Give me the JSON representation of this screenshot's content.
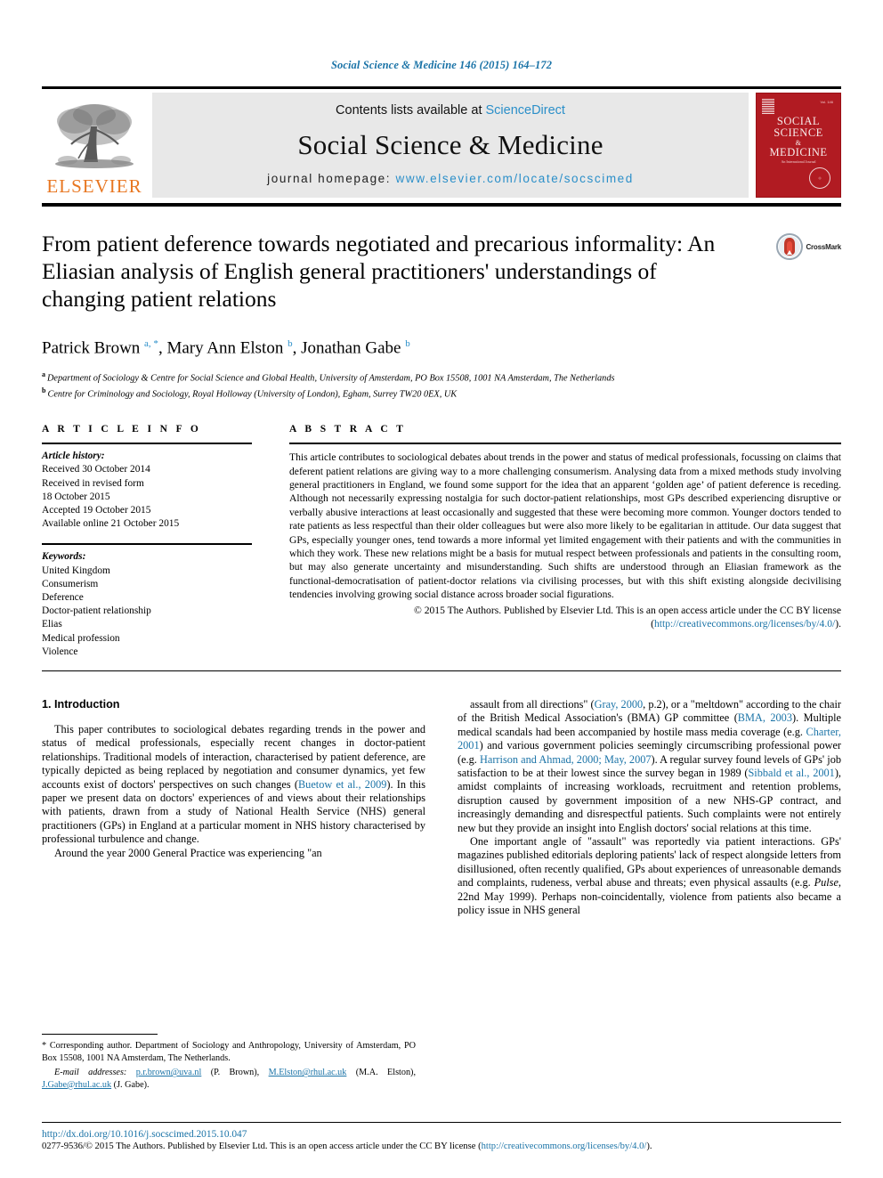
{
  "running_head": "Social Science & Medicine 146 (2015) 164–172",
  "masthead": {
    "contents_prefix": "Contents lists available at ",
    "contents_link": "ScienceDirect",
    "journal_name": "Social Science & Medicine",
    "homepage_prefix": "journal homepage: ",
    "homepage_url": "www.elsevier.com/locate/socscimed",
    "publisher_name": "ELSEVIER",
    "publisher_logo_icon": "elsevier-tree-icon",
    "cover": {
      "line1": "SOCIAL",
      "line2": "SCIENCE",
      "amp": "&",
      "line3": "MEDICINE",
      "subtitle": "An International Journal",
      "corner_label": "Vol. 146"
    },
    "colors": {
      "link": "#2b8fc9",
      "elsevier_orange": "#E87722",
      "cover_red": "#b11b22",
      "band": "#e8e8e8"
    }
  },
  "article": {
    "title": "From patient deference towards negotiated and precarious informality: An Eliasian analysis of English general practitioners' understandings of changing patient relations",
    "authors": [
      {
        "name": "Patrick Brown",
        "marks": "a, *"
      },
      {
        "name": "Mary Ann Elston",
        "marks": "b"
      },
      {
        "name": "Jonathan Gabe",
        "marks": "b"
      }
    ],
    "affiliations": [
      {
        "mark": "a",
        "text": "Department of Sociology & Centre for Social Science and Global Health, University of Amsterdam, PO Box 15508, 1001 NA Amsterdam, The Netherlands"
      },
      {
        "mark": "b",
        "text": "Centre for Criminology and Sociology, Royal Holloway (University of London), Egham, Surrey TW20 0EX, UK"
      }
    ],
    "crossmark_label": "CrossMark"
  },
  "article_info": {
    "heading": "ARTICLE INFO",
    "history_label": "Article history:",
    "history": [
      "Received 30 October 2014",
      "Received in revised form",
      "18 October 2015",
      "Accepted 19 October 2015",
      "Available online 21 October 2015"
    ],
    "keywords_label": "Keywords:",
    "keywords": [
      "United Kingdom",
      "Consumerism",
      "Deference",
      "Doctor-patient relationship",
      "Elias",
      "Medical profession",
      "Violence"
    ]
  },
  "abstract": {
    "heading": "ABSTRACT",
    "text": "This article contributes to sociological debates about trends in the power and status of medical professionals, focussing on claims that deferent patient relations are giving way to a more challenging consumerism. Analysing data from a mixed methods study involving general practitioners in England, we found some support for the idea that an apparent ‘golden age’ of patient deference is receding. Although not necessarily expressing nostalgia for such doctor-patient relationships, most GPs described experiencing disruptive or verbally abusive interactions at least occasionally and suggested that these were becoming more common. Younger doctors tended to rate patients as less respectful than their older colleagues but were also more likely to be egalitarian in attitude. Our data suggest that GPs, especially younger ones, tend towards a more informal yet limited engagement with their patients and with the communities in which they work. These new relations might be a basis for mutual respect between professionals and patients in the consulting room, but may also generate uncertainty and misunderstanding. Such shifts are understood through an Eliasian framework as the functional-democratisation of patient-doctor relations via civilising processes, but with this shift existing alongside decivilising tendencies involving growing social distance across broader social figurations.",
    "copyright": "© 2015 The Authors. Published by Elsevier Ltd. This is an open access article under the CC BY license",
    "license_open": "(",
    "license_url": "http://creativecommons.org/licenses/by/4.0/",
    "license_close": ")."
  },
  "body": {
    "section_number_title": "1. Introduction",
    "left_paragraphs": [
      {
        "parts": [
          {
            "t": "This paper contributes to sociological debates regarding trends in the power and status of medical professionals, especially recent changes in doctor-patient relationships. Traditional models of interaction, characterised by patient deference, are typically depicted as being replaced by negotiation and consumer dynamics, yet few accounts exist of doctors' perspectives on such changes ("
          },
          {
            "t": "Buetow et al., 2009",
            "ref": true
          },
          {
            "t": "). In this paper we present data on doctors' experiences of and views about their relationships with patients, drawn from a study of National Health Service (NHS) general practitioners (GPs) in England at a particular moment in NHS history characterised by professional turbulence and change."
          }
        ]
      },
      {
        "parts": [
          {
            "t": "Around the year 2000 General Practice was experiencing \"an"
          }
        ]
      }
    ],
    "right_paragraphs": [
      {
        "parts": [
          {
            "t": "assault from all directions\" ("
          },
          {
            "t": "Gray, 2000",
            "ref": true
          },
          {
            "t": ", p.2), or a \"meltdown\" according to the chair of the British Medical Association's (BMA) GP committee ("
          },
          {
            "t": "BMA, 2003",
            "ref": true
          },
          {
            "t": "). Multiple medical scandals had been accompanied by hostile mass media coverage (e.g. "
          },
          {
            "t": "Charter, 2001",
            "ref": true
          },
          {
            "t": ") and various government policies seemingly circumscribing professional power (e.g. "
          },
          {
            "t": "Harrison and Ahmad, 2000; May, 2007",
            "ref": true
          },
          {
            "t": "). A regular survey found levels of GPs' job satisfaction to be at their lowest since the survey began in 1989 ("
          },
          {
            "t": "Sibbald et al., 2001",
            "ref": true
          },
          {
            "t": "), amidst complaints of increasing workloads, recruitment and retention problems, disruption caused by government imposition of a new NHS-GP contract, and increasingly demanding and disrespectful patients. Such complaints were not entirely new but they provide an insight into English doctors' social relations at this time."
          }
        ]
      },
      {
        "parts": [
          {
            "t": "One important angle of \"assault\" was reportedly via patient interactions. GPs' magazines published editorials deploring patients' lack of respect alongside letters from disillusioned, often recently qualified, GPs about experiences of unreasonable demands and complaints, rudeness, verbal abuse and threats; even physical assaults (e.g. "
          },
          {
            "t": "Pulse",
            "italic": true
          },
          {
            "t": ", 22nd May 1999). Perhaps non-coincidentally, violence from patients also became a policy issue in NHS general"
          }
        ]
      }
    ]
  },
  "footnotes": {
    "corresponding": "* Corresponding author. Department of Sociology and Anthropology, University of Amsterdam, PO Box 15508, 1001 NA Amsterdam, The Netherlands.",
    "email_label": "E-mail addresses:",
    "emails": [
      {
        "address": "p.r.brown@uva.nl",
        "owner": "(P. Brown),"
      },
      {
        "address": "M.Elston@rhul.ac.uk",
        "owner": "(M.A. Elston),"
      },
      {
        "address": "J.Gabe@rhul.ac.uk",
        "owner": "(J. Gabe)."
      }
    ]
  },
  "page_footer": {
    "doi": "http://dx.doi.org/10.1016/j.socscimed.2015.10.047",
    "issn_copyright": "0277-9536/© 2015 The Authors. Published by Elsevier Ltd. This is an open access article under the CC BY license (",
    "license_url": "http://creativecommons.org/licenses/by/4.0/",
    "issn_close": ")."
  }
}
